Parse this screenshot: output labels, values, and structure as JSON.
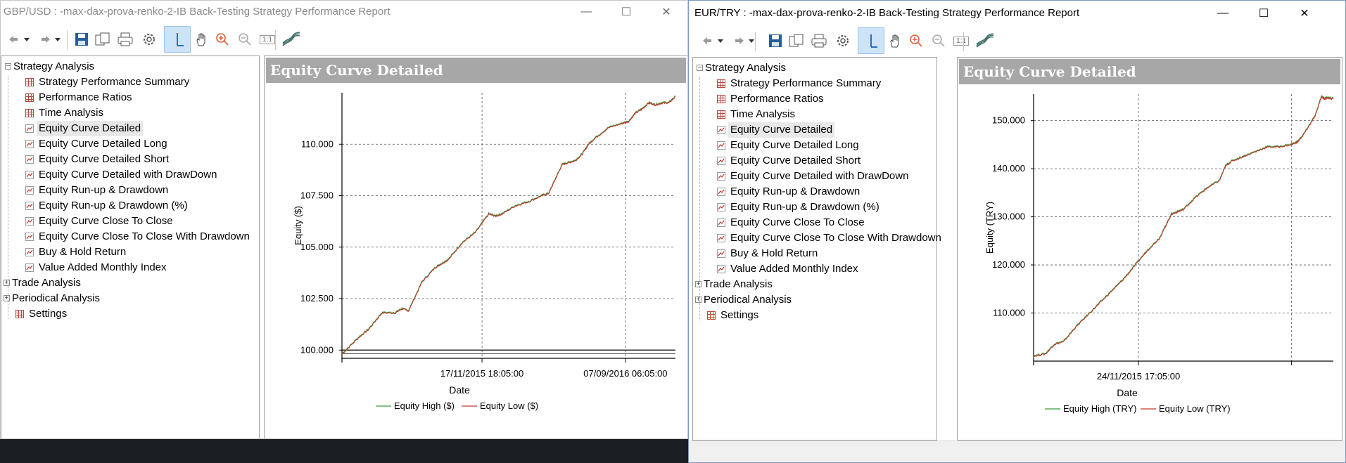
{
  "windows": [
    {
      "title": "GBP/USD : -max-dax-prova-renko-2-IB Back-Testing Strategy Performance Report",
      "tree": {
        "root": "Strategy Analysis",
        "children": [
          {
            "label": "Strategy Performance Summary",
            "icon": "grid-icon"
          },
          {
            "label": "Performance Ratios",
            "icon": "grid-icon"
          },
          {
            "label": "Time Analysis",
            "icon": "grid-icon"
          },
          {
            "label": "Equity Curve Detailed",
            "icon": "chart-icon",
            "selected": true
          },
          {
            "label": "Equity Curve Detailed Long",
            "icon": "chart-icon"
          },
          {
            "label": "Equity Curve Detailed Short",
            "icon": "chart-icon"
          },
          {
            "label": "Equity Curve Detailed with DrawDown",
            "icon": "chart-icon"
          },
          {
            "label": "Equity Run-up & Drawdown",
            "icon": "chart-icon"
          },
          {
            "label": "Equity Run-up & Drawdown (%)",
            "icon": "chart-icon"
          },
          {
            "label": "Equity Curve Close To Close",
            "icon": "chart-icon"
          },
          {
            "label": "Equity Curve Close To Close With Drawdown",
            "icon": "chart-icon"
          },
          {
            "label": "Buy & Hold Return",
            "icon": "chart-icon"
          },
          {
            "label": "Value Added Monthly Index",
            "icon": "chart-icon"
          }
        ],
        "siblings": [
          "Trade Analysis",
          "Periodical Analysis"
        ],
        "settings": "Settings"
      },
      "panel_title": "Equity Curve Detailed"
    },
    {
      "title": "EUR/TRY : -max-dax-prova-renko-2-IB Back-Testing Strategy Performance Report",
      "tree": {
        "root": "Strategy Analysis",
        "children": [
          {
            "label": "Strategy Performance Summary",
            "icon": "grid-icon"
          },
          {
            "label": "Performance Ratios",
            "icon": "grid-icon"
          },
          {
            "label": "Time Analysis",
            "icon": "grid-icon"
          },
          {
            "label": "Equity Curve Detailed",
            "icon": "chart-icon",
            "selected": true
          },
          {
            "label": "Equity Curve Detailed Long",
            "icon": "chart-icon"
          },
          {
            "label": "Equity Curve Detailed Short",
            "icon": "chart-icon"
          },
          {
            "label": "Equity Curve Detailed with DrawDown",
            "icon": "chart-icon"
          },
          {
            "label": "Equity Run-up & Drawdown",
            "icon": "chart-icon"
          },
          {
            "label": "Equity Run-up & Drawdown (%)",
            "icon": "chart-icon"
          },
          {
            "label": "Equity Curve Close To Close",
            "icon": "chart-icon"
          },
          {
            "label": "Equity Curve Close To Close With Drawdown",
            "icon": "chart-icon"
          },
          {
            "label": "Buy & Hold Return",
            "icon": "chart-icon"
          },
          {
            "label": "Value Added Monthly Index",
            "icon": "chart-icon"
          }
        ],
        "siblings": [
          "Trade Analysis",
          "Periodical Analysis"
        ],
        "settings": "Settings"
      },
      "panel_title": "Equity Curve Detailed"
    }
  ],
  "toolbar_icons": [
    "back-arrow-icon",
    "dropdown-arrow-icon",
    "forward-arrow-icon",
    "dropdown-arrow-icon",
    "save-icon",
    "copy-icon",
    "print-icon",
    "settings-gear-icon",
    "crosshair-cursor-icon",
    "hand-pan-icon",
    "zoom-in-icon",
    "zoom-out-icon",
    "zoom-reset-icon",
    "chart-style-icon"
  ],
  "zoom_reset_label": "1:1",
  "colors": {
    "equity_high": "#3a9a3a",
    "equity_low": "#c0392b",
    "panel_header": "#a7a7a7",
    "selected_tool": "#cde3f8"
  },
  "chart_data": [
    {
      "type": "line",
      "title": "",
      "xlabel": "Date",
      "ylabel": "Equity ($)",
      "ylim": [
        99600,
        112500
      ],
      "yticks": [
        100000,
        102500,
        105000,
        107500,
        110000
      ],
      "ytick_labels": [
        "100.000",
        "102.500",
        "105.000",
        "107.500",
        "110.000"
      ],
      "xtick_labels": [
        "17/11/2015 18:05:00",
        "07/09/2016 06:05:00"
      ],
      "legend": "bottom-center",
      "series": [
        {
          "name": "Equity High ($)",
          "color": "#3a9a3a"
        },
        {
          "name": "Equity Low ($)",
          "color": "#c0392b"
        }
      ],
      "x": [
        0,
        0.05,
        0.08,
        0.12,
        0.16,
        0.18,
        0.2,
        0.24,
        0.28,
        0.3,
        0.32,
        0.36,
        0.4,
        0.44,
        0.46,
        0.48,
        0.52,
        0.56,
        0.6,
        0.62,
        0.64,
        0.66,
        0.68,
        0.7,
        0.72,
        0.74,
        0.76,
        0.8,
        0.84,
        0.86,
        0.88,
        0.9,
        0.92,
        0.94,
        0.96,
        0.98,
        1.0
      ],
      "y": [
        99800,
        100600,
        101000,
        101800,
        101800,
        102000,
        101900,
        103300,
        104000,
        104200,
        104400,
        105200,
        105700,
        106600,
        106500,
        106600,
        107000,
        107200,
        107500,
        107600,
        108300,
        109000,
        109100,
        109200,
        109500,
        110000,
        110300,
        110800,
        111000,
        111100,
        111500,
        111700,
        112000,
        111900,
        112000,
        112000,
        112300
      ]
    },
    {
      "type": "line",
      "title": "",
      "xlabel": "Date",
      "ylabel": "Equity (TRY)",
      "ylim": [
        100000,
        155500
      ],
      "yticks": [
        110000,
        120000,
        130000,
        140000,
        150000
      ],
      "ytick_labels": [
        "110.000",
        "120.000",
        "130.000",
        "140.000",
        "150.000"
      ],
      "xtick_labels": [
        "24/11/2015 17:05:00"
      ],
      "legend": "bottom-center",
      "series": [
        {
          "name": "Equity High (TRY)",
          "color": "#3a9a3a"
        },
        {
          "name": "Equity Low (TRY)",
          "color": "#c0392b"
        }
      ],
      "x": [
        0,
        0.04,
        0.07,
        0.1,
        0.14,
        0.18,
        0.22,
        0.26,
        0.3,
        0.34,
        0.38,
        0.42,
        0.44,
        0.46,
        0.48,
        0.5,
        0.54,
        0.58,
        0.62,
        0.64,
        0.66,
        0.7,
        0.74,
        0.78,
        0.82,
        0.86,
        0.88,
        0.9,
        0.92,
        0.94,
        0.96,
        0.97,
        0.98,
        1.0
      ],
      "y": [
        101000,
        101500,
        103500,
        104000,
        107000,
        109500,
        112000,
        114500,
        117000,
        120000,
        123000,
        125500,
        128000,
        130500,
        131000,
        131500,
        134000,
        136000,
        137500,
        140500,
        141500,
        142500,
        143500,
        144500,
        144500,
        145000,
        145500,
        147000,
        149000,
        151000,
        155000,
        154500,
        154700,
        154500
      ]
    }
  ]
}
